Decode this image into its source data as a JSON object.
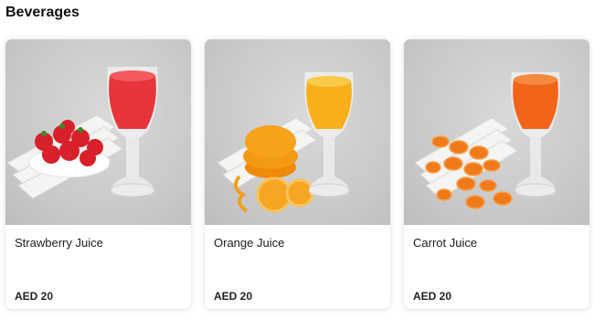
{
  "section": {
    "title": "Beverages"
  },
  "products": [
    {
      "name": "Strawberry Juice",
      "price": "AED 20",
      "image_icon": "strawberry-juice-image",
      "juice_color": "#e8343b"
    },
    {
      "name": "Orange Juice",
      "price": "AED 20",
      "image_icon": "orange-juice-image",
      "juice_color": "#f5a40f"
    },
    {
      "name": "Carrot Juice",
      "price": "AED 20",
      "image_icon": "carrot-juice-image",
      "juice_color": "#f2641a"
    }
  ]
}
